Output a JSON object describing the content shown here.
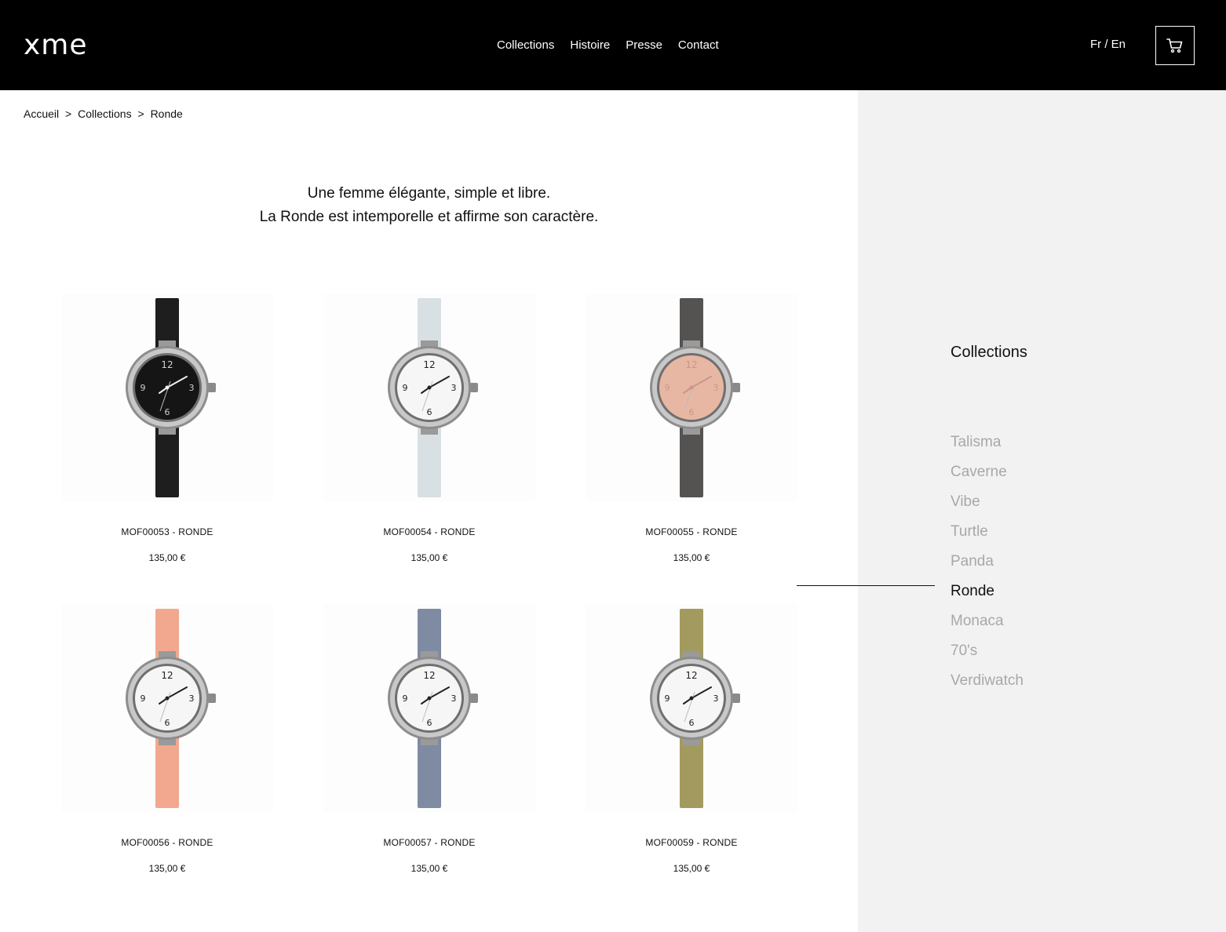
{
  "header": {
    "logo": "xme",
    "nav": [
      "Collections",
      "Histoire",
      "Presse",
      "Contact"
    ],
    "lang": "Fr / En"
  },
  "breadcrumb": [
    "Accueil",
    ">",
    "Collections",
    ">",
    "Ronde"
  ],
  "intro": {
    "line1": "Une femme élégante, simple et libre.",
    "line2": "La Ronde est intemporelle et affirme son caractère."
  },
  "sidebar": {
    "title": "Collections",
    "items": [
      "Talisma",
      "Caverne",
      "Vibe",
      "Turtle",
      "Panda",
      "Ronde",
      "Monaca",
      "70's",
      "Verdiwatch"
    ],
    "active": "Ronde"
  },
  "products": [
    {
      "name": "MOF00053 - RONDE",
      "price": "135,00 €",
      "strap": "#1e1e1e",
      "dial": "#151515",
      "numerals": "#cfcfcf",
      "hands": "#f0f0f0"
    },
    {
      "name": "MOF00054 - RONDE",
      "price": "135,00 €",
      "strap": "#d9e0e3",
      "dial": "#f6f6f6",
      "numerals": "#222222",
      "hands": "#222222"
    },
    {
      "name": "MOF00055 - RONDE",
      "price": "135,00 €",
      "strap": "#555351",
      "dial": "#e7b7a3",
      "numerals": "#c9968a",
      "hands": "#c9968a"
    },
    {
      "name": "MOF00056 - RONDE",
      "price": "135,00 €",
      "strap": "#f1a88e",
      "dial": "#f6f6f6",
      "numerals": "#222222",
      "hands": "#222222"
    },
    {
      "name": "MOF00057 - RONDE",
      "price": "135,00 €",
      "strap": "#7f8aa3",
      "dial": "#f6f6f6",
      "numerals": "#222222",
      "hands": "#222222"
    },
    {
      "name": "MOF00059 - RONDE",
      "price": "135,00 €",
      "strap": "#a39a5f",
      "dial": "#f6f6f6",
      "numerals": "#222222",
      "hands": "#222222"
    }
  ]
}
